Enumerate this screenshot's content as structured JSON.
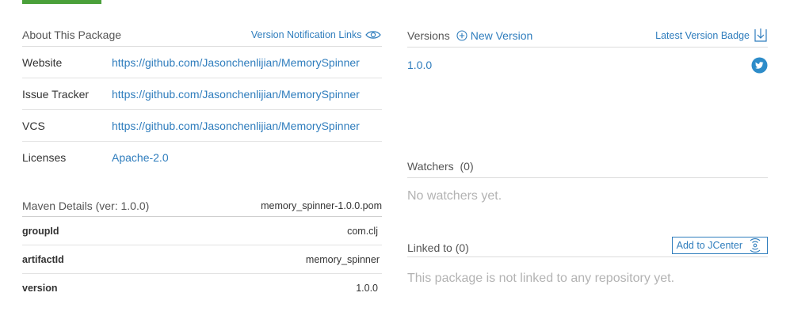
{
  "about": {
    "title": "About This Package",
    "notification_link": "Version Notification Links",
    "rows": [
      {
        "key": "Website",
        "value": "https://github.com/Jasonchenlijian/MemorySpinner"
      },
      {
        "key": "Issue Tracker",
        "value": "https://github.com/Jasonchenlijian/MemorySpinner"
      },
      {
        "key": "VCS",
        "value": "https://github.com/Jasonchenlijian/MemorySpinner"
      },
      {
        "key": "Licenses",
        "value": "Apache-2.0"
      }
    ]
  },
  "maven": {
    "title": "Maven Details (ver: 1.0.0)",
    "pom_link": "memory_spinner-1.0.0.pom",
    "rows": [
      {
        "key": "groupId",
        "value": "com.clj"
      },
      {
        "key": "artifactId",
        "value": "memory_spinner"
      },
      {
        "key": "version",
        "value": "1.0.0"
      }
    ]
  },
  "versions": {
    "title": "Versions",
    "new_version_label": "New Version",
    "badge_link": "Latest Version Badge",
    "items": [
      "1.0.0"
    ]
  },
  "watchers": {
    "title": "Watchers",
    "count": "(0)",
    "empty_text": "No watchers yet."
  },
  "linked": {
    "title": "Linked to (0)",
    "button_label": "Add to JCenter",
    "empty_text": "This package is not linked to any repository yet."
  },
  "icons": {
    "eye": "eye-icon",
    "plus": "plus-circle-icon",
    "badge": "badge-download-icon",
    "twitter": "twitter-icon",
    "jcenter": "jcenter-broadcast-icon"
  },
  "colors": {
    "link": "#2f7dbd",
    "accent_green": "#4aa03a",
    "muted": "#b3b3b3",
    "twitter": "#2d8cc9"
  }
}
